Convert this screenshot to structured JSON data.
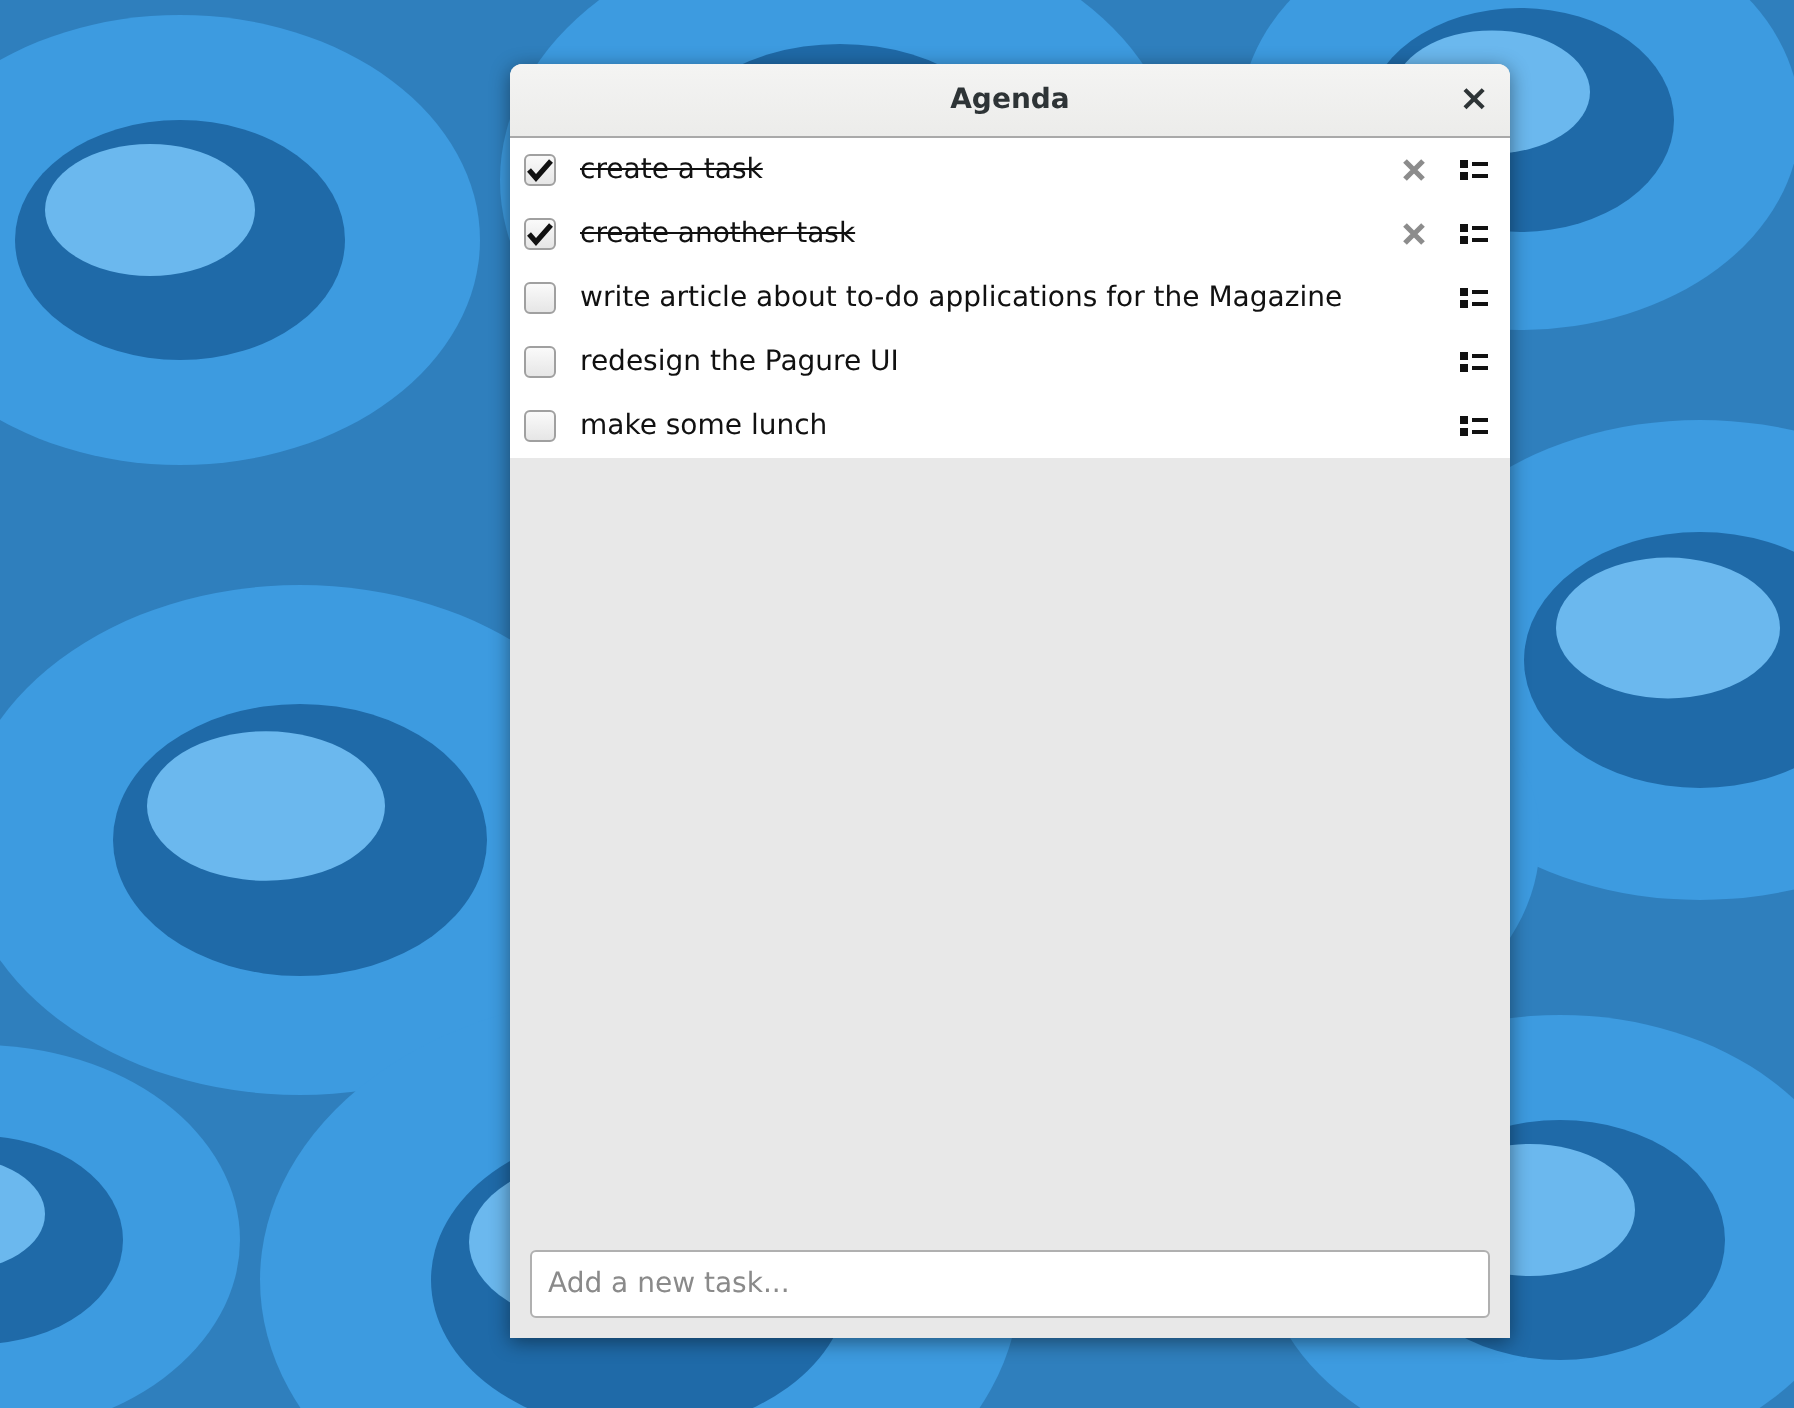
{
  "window": {
    "title": "Agenda",
    "close": "×"
  },
  "tasks": [
    {
      "text": "create a task",
      "done": true
    },
    {
      "text": "create another task",
      "done": true
    },
    {
      "text": "write article about to-do applications for the Magazine",
      "done": false
    },
    {
      "text": "redesign the Pagure UI",
      "done": false
    },
    {
      "text": "make some lunch",
      "done": false
    }
  ],
  "new_task": {
    "placeholder": "Add a new task..."
  }
}
